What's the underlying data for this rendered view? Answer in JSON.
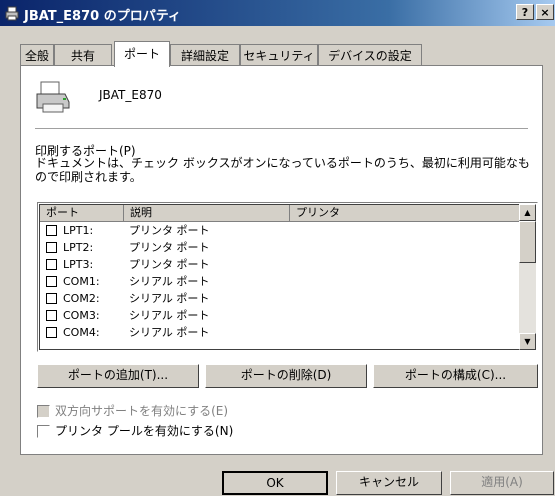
{
  "window": {
    "title": "JBAT_E870 のプロパティ",
    "help_btn": "?",
    "close_btn": "×"
  },
  "tabs": [
    "全般",
    "共有",
    "ポート",
    "詳細設定",
    "セキュリティ",
    "デバイスの設定"
  ],
  "active_tab": "ポート",
  "printer": {
    "name": "JBAT_E870",
    "icon": "printer-icon"
  },
  "ports_label": "印刷するポート(P)",
  "ports_desc": "ドキュメントは、チェック ボックスがオンになっているポートのうち、最初に利用可能なもので印刷されます。",
  "list": {
    "headers": [
      "ポート",
      "説明",
      "プリンタ"
    ],
    "rows": [
      {
        "port": "LPT1:",
        "desc": "プリンタ ポート",
        "checked": false
      },
      {
        "port": "LPT2:",
        "desc": "プリンタ ポート",
        "checked": false
      },
      {
        "port": "LPT3:",
        "desc": "プリンタ ポート",
        "checked": false
      },
      {
        "port": "COM1:",
        "desc": "シリアル ポート",
        "checked": false
      },
      {
        "port": "COM2:",
        "desc": "シリアル ポート",
        "checked": false
      },
      {
        "port": "COM3:",
        "desc": "シリアル ポート",
        "checked": false
      },
      {
        "port": "COM4:",
        "desc": "シリアル ポート",
        "checked": false
      }
    ]
  },
  "buttons": {
    "add_port": "ポートの追加(T)...",
    "delete_port": "ポートの削除(D)",
    "configure_port": "ポートの構成(C)..."
  },
  "checkboxes": {
    "bidirectional": {
      "label": "双方向サポートを有効にする(E)",
      "enabled": false,
      "checked": false
    },
    "pool": {
      "label": "プリンタ プールを有効にする(N)",
      "enabled": true,
      "checked": false
    }
  },
  "bottom": {
    "ok": "OK",
    "cancel": "キャンセル",
    "apply": "適用(A)"
  }
}
